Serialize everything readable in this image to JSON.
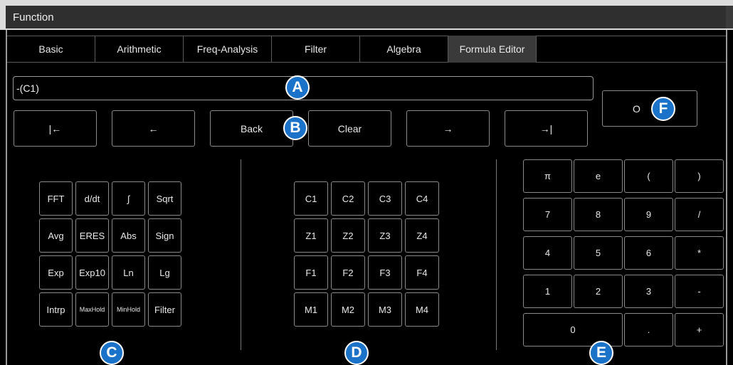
{
  "window": {
    "title": "Function"
  },
  "tabs": [
    "Basic",
    "Arithmetic",
    "Freq-Analysis",
    "Filter",
    "Algebra",
    "Formula Editor"
  ],
  "formula": {
    "value": "-(C1)"
  },
  "nav_buttons": {
    "home": "|←",
    "left": "←",
    "back": "Back",
    "clear": "Clear",
    "right": "→",
    "end": "→|"
  },
  "ok_label": "O",
  "functions": [
    "FFT",
    "d/dt",
    "∫",
    "Sqrt",
    "Avg",
    "ERES",
    "Abs",
    "Sign",
    "Exp",
    "Exp10",
    "Ln",
    "Lg",
    "Intrp",
    "MaxHold",
    "MinHold",
    "Filter"
  ],
  "sources": [
    "C1",
    "C2",
    "C3",
    "C4",
    "Z1",
    "Z2",
    "Z3",
    "Z4",
    "F1",
    "F2",
    "F3",
    "F4",
    "M1",
    "M2",
    "M3",
    "M4"
  ],
  "keypad": [
    "π",
    "e",
    "(",
    ")",
    "7",
    "8",
    "9",
    "/",
    "4",
    "5",
    "6",
    "*",
    "1",
    "2",
    "3",
    "-",
    "0",
    ".",
    "+"
  ],
  "markers": {
    "a": "A",
    "b": "B",
    "c": "C",
    "d": "D",
    "e": "E",
    "f": "F"
  },
  "colors": {
    "marker_blue": "#1a73c8",
    "active_tab": "#3a3a3a",
    "title_bar": "#2f2f2f"
  }
}
